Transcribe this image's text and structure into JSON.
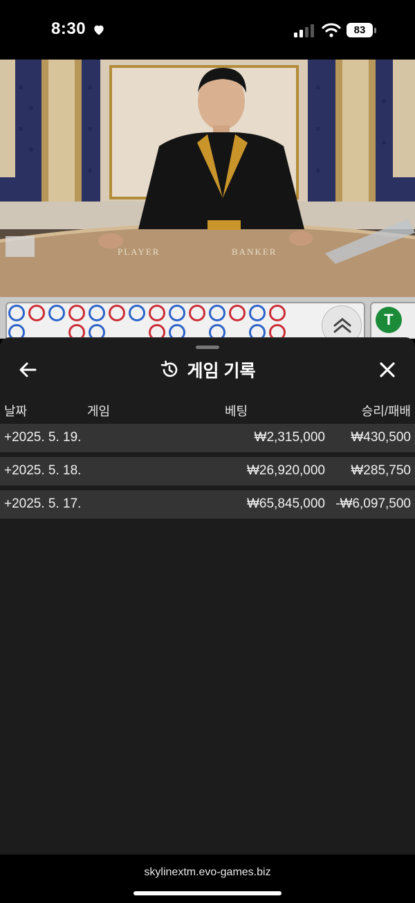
{
  "status_bar": {
    "time": "8:30",
    "battery": "83",
    "icons": [
      "heart-icon",
      "signal-icon",
      "wifi-icon",
      "battery-icon"
    ]
  },
  "video": {
    "table_labels": {
      "player": "PLAYER",
      "banker": "BANKER"
    }
  },
  "scoreboard": {
    "tie_label": "T",
    "colors": {
      "player": "#2c63c9",
      "banker": "#cc2d35",
      "tie": "#1b8b3a"
    }
  },
  "panel": {
    "title": "게임 기록",
    "icons": {
      "back": "arrow-left-icon",
      "history": "history-icon",
      "close": "close-icon"
    },
    "columns": {
      "date": "날짜",
      "game": "게임",
      "bet": "베팅",
      "result": "승리/패배"
    },
    "rows": [
      {
        "date": "+2025. 5. 19.",
        "bet": "₩2,315,000",
        "result": "₩430,500"
      },
      {
        "date": "+2025. 5. 18.",
        "bet": "₩26,920,000",
        "result": "₩285,750"
      },
      {
        "date": "+2025. 5. 17.",
        "bet": "₩65,845,000",
        "result": "-₩6,097,500"
      }
    ]
  },
  "browser": {
    "url": "skylinextm.evo-games.biz"
  }
}
